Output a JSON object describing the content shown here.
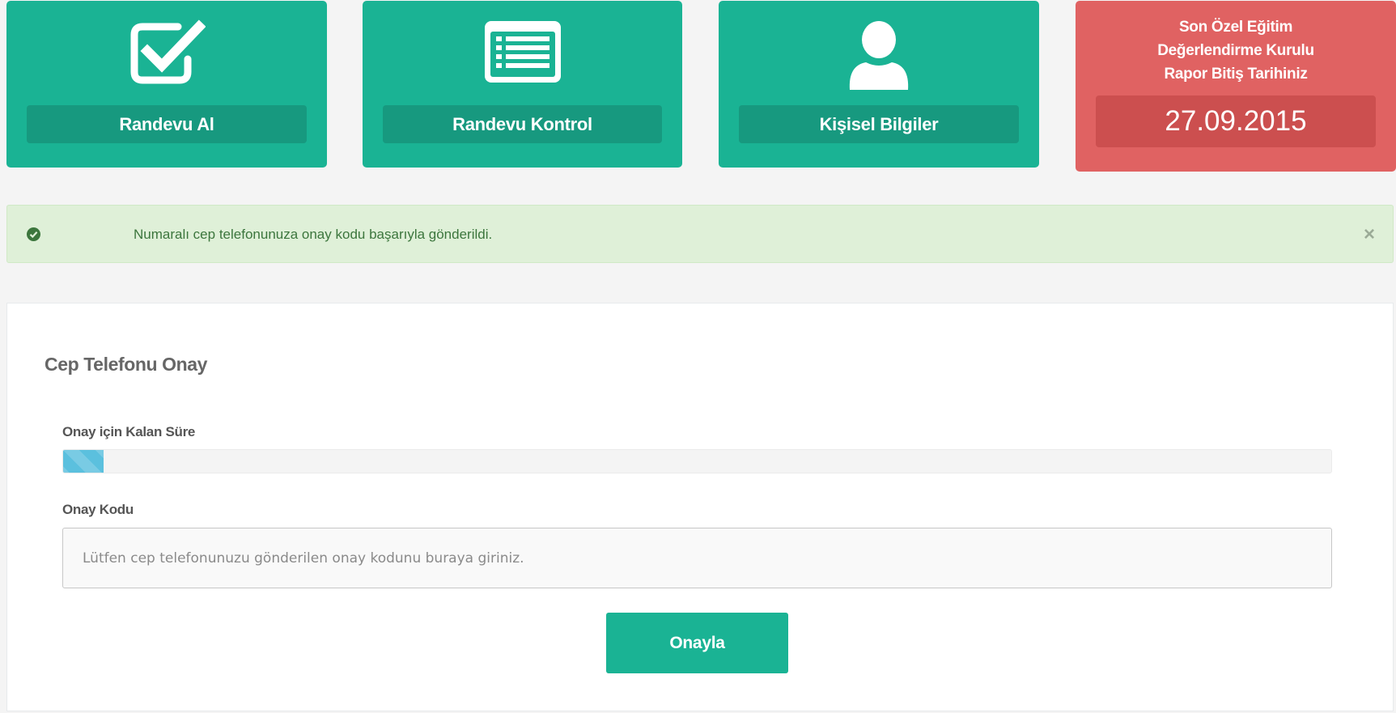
{
  "tiles": [
    {
      "label": "Randevu Al",
      "icon": "checkbox-checked-icon"
    },
    {
      "label": "Randevu Kontrol",
      "icon": "list-icon"
    },
    {
      "label": "Kişisel Bilgiler",
      "icon": "user-icon"
    }
  ],
  "report": {
    "title_line1": "Son Özel Eğitim",
    "title_line2": "Değerlendirme Kurulu",
    "title_line3": "Rapor Bitiş Tarihiniz",
    "date": "27.09.2015"
  },
  "alert": {
    "message": "Numaralı cep telefonunuza onay kodu başarıyla gönderildi.",
    "close_symbol": "×",
    "icon": "check-circle-icon"
  },
  "panel": {
    "title": "Cep Telefonu Onay",
    "remaining_label": "Onay için Kalan Süre",
    "remaining_fraction": 0.032,
    "code_label": "Onay Kodu",
    "code_placeholder": "Lütfen cep telefonunuzu gönderilen onay kodunu buraya giriniz.",
    "code_value": "",
    "confirm_label": "Onayla"
  },
  "colors": {
    "accent": "#1ab394",
    "danger": "#e06262",
    "success_bg": "#dff0d8",
    "progress": "#5bc0de"
  }
}
